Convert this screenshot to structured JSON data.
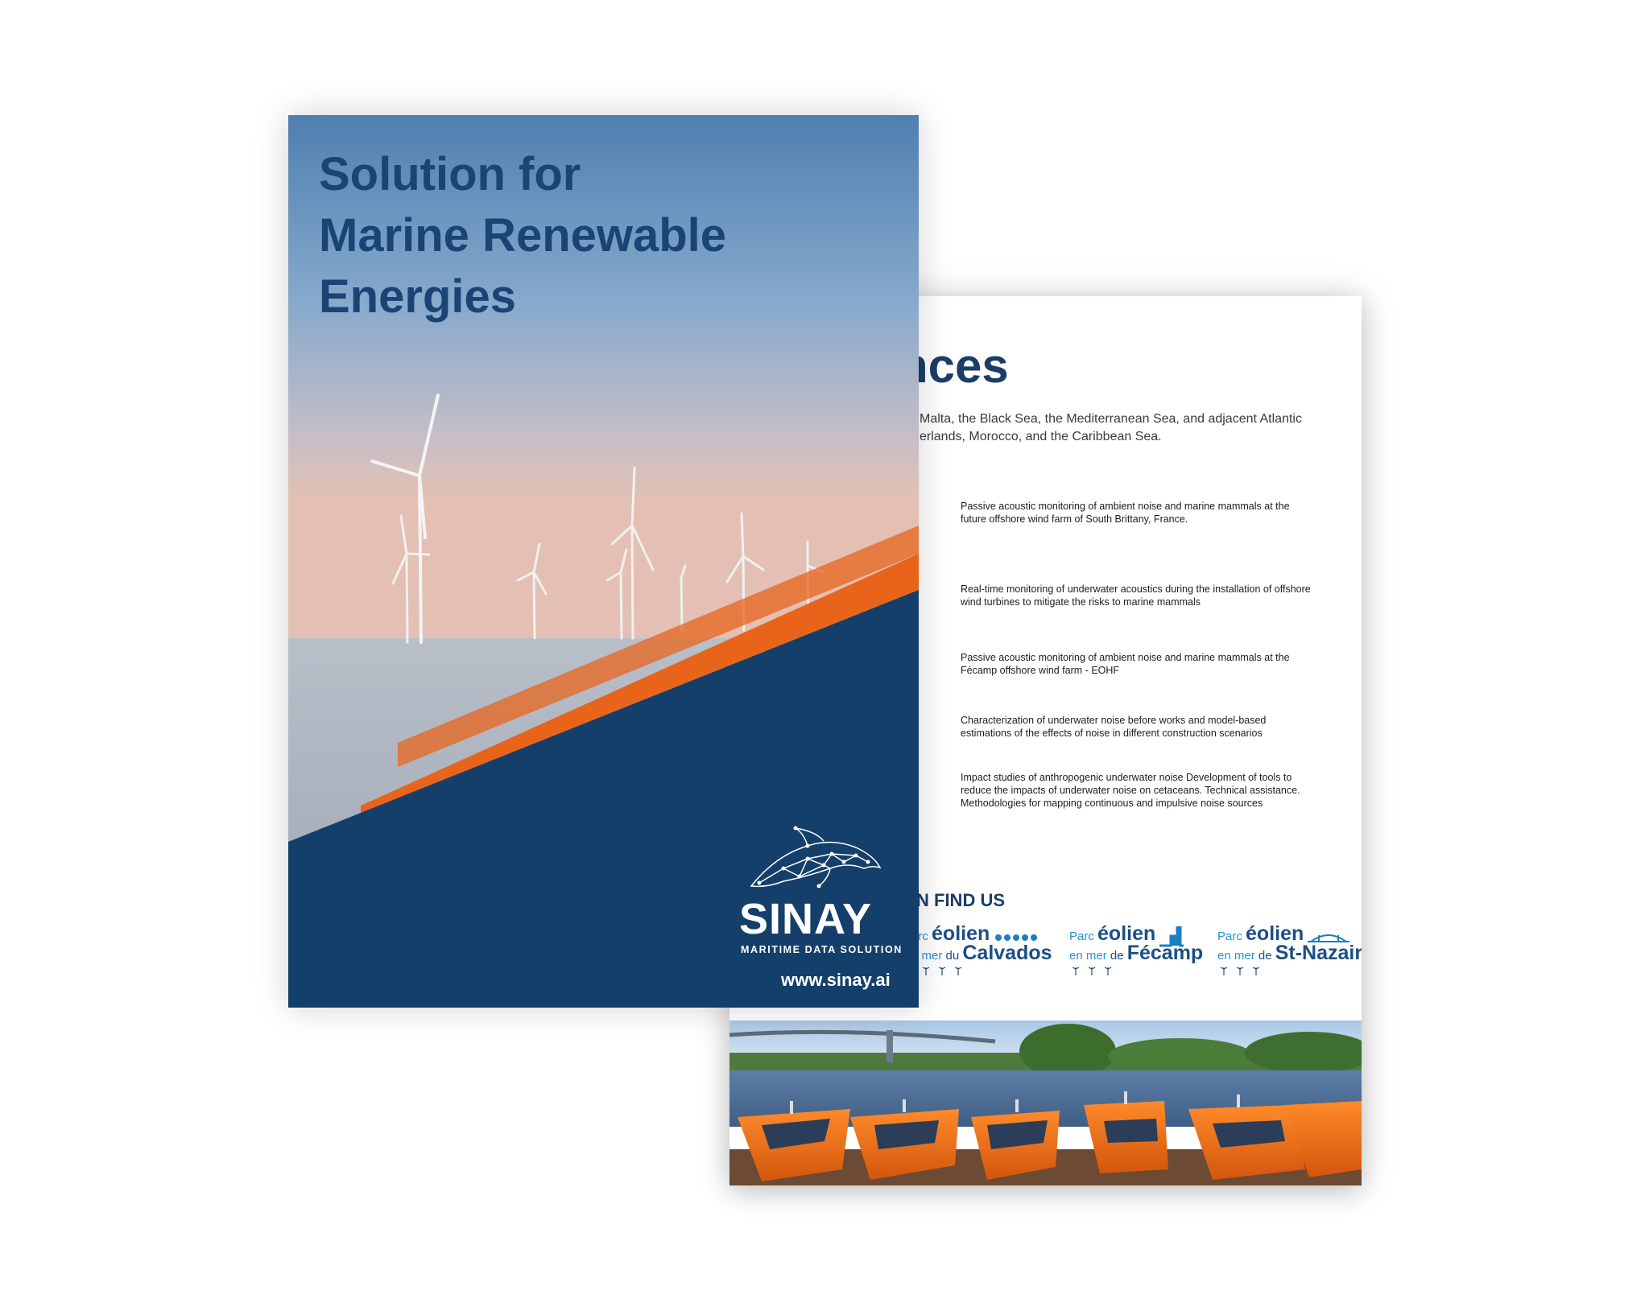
{
  "cover": {
    "title_lines": [
      "Solution for",
      "Marine Renewable",
      "Energies"
    ],
    "brand": "SINAY",
    "tagline": "MARITIME DATA SOLUTION",
    "website": "www.sinay.ai",
    "logo_icon": "dolphin-network-icon",
    "colors": {
      "navy": "#143f6b",
      "orange": "#e8641b",
      "title": "#1a4476"
    }
  },
  "back": {
    "title_fragment": "nces",
    "intro_line_1": "Malta, the Black Sea, the Mediterranean Sea, and adjacent Atlantic",
    "intro_line_2": "erlands, Morocco, and the Caribbean Sea.",
    "references": [
      "Passive acoustic monitoring of ambient noise and marine mammals at the future offshore wind farm of South Brittany, France.",
      "Real-time monitoring of underwater acoustics during the installation of offshore wind turbines to mitigate the risks to marine mammals",
      "Passive acoustic monitoring of ambient noise and marine mammals at the Fécamp offshore wind farm - EOHF",
      "Characterization of underwater noise before works and model-based estimations of the effects of noise in different construction scenarios",
      "Impact studies of anthropogenic underwater noise Development of tools to reduce the impacts of underwater noise on cetaceans. Technical assistance. Methodologies for mapping continuous and impulsive noise sources"
    ],
    "find_us": "N FIND US",
    "parks": {
      "calvados": {
        "p1": "arc ",
        "p2": "éolien",
        "p3": "n mer ",
        "p4": "du ",
        "p5": "Calvados"
      },
      "fecamp": {
        "p1": "Parc ",
        "p2": "éolien",
        "p3": "en mer ",
        "p4": "de ",
        "p5": "Fécamp"
      },
      "nazaire": {
        "p1": "Parc ",
        "p2": "éolien",
        "p3": "en mer ",
        "p4": "de ",
        "p5": "St-Nazaire"
      }
    }
  }
}
